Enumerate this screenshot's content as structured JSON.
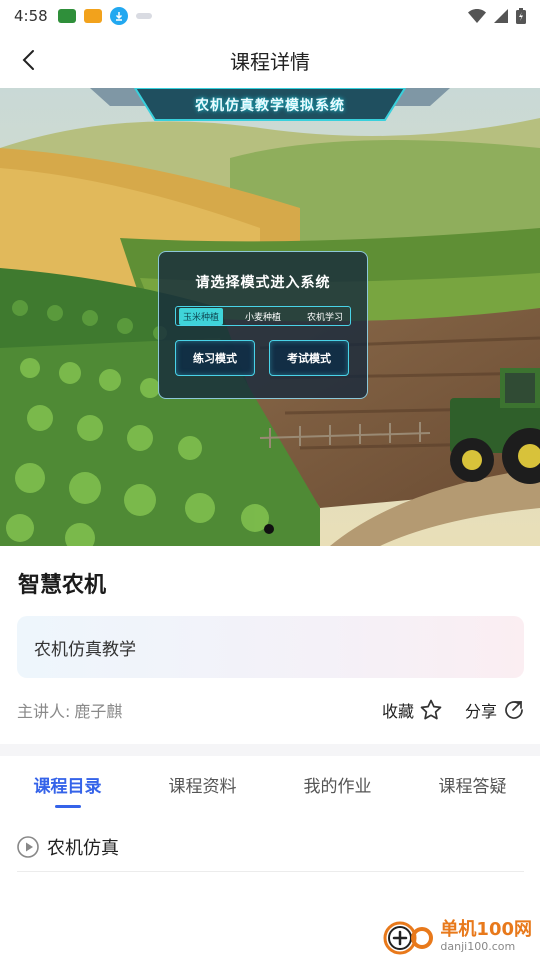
{
  "status_bar": {
    "time": "4:58"
  },
  "header": {
    "title": "课程详情"
  },
  "banner": {
    "system_title": "农机仿真教学模拟系统",
    "panel_title": "请选择模式进入系统",
    "mode_tabs": [
      {
        "label": "玉米种植",
        "active": true
      },
      {
        "label": "小麦种植",
        "active": false
      },
      {
        "label": "农机学习",
        "active": false
      }
    ],
    "practice_button": "练习模式",
    "exam_button": "考试模式"
  },
  "course": {
    "title": "智慧农机",
    "description": "农机仿真教学",
    "teacher_label": "主讲人:",
    "teacher_name": "鹿子麒",
    "favorite_label": "收藏",
    "share_label": "分享"
  },
  "tabs": [
    {
      "label": "课程目录",
      "active": true
    },
    {
      "label": "课程资料",
      "active": false
    },
    {
      "label": "我的作业",
      "active": false
    },
    {
      "label": "课程答疑",
      "active": false
    }
  ],
  "catalog": [
    {
      "label": "农机仿真"
    }
  ],
  "watermark": {
    "title": "单机100网",
    "url": "danji100.com"
  },
  "colors": {
    "accent": "#3563e9",
    "panel_border": "#49d3e8",
    "watermark": "#e8791b"
  }
}
